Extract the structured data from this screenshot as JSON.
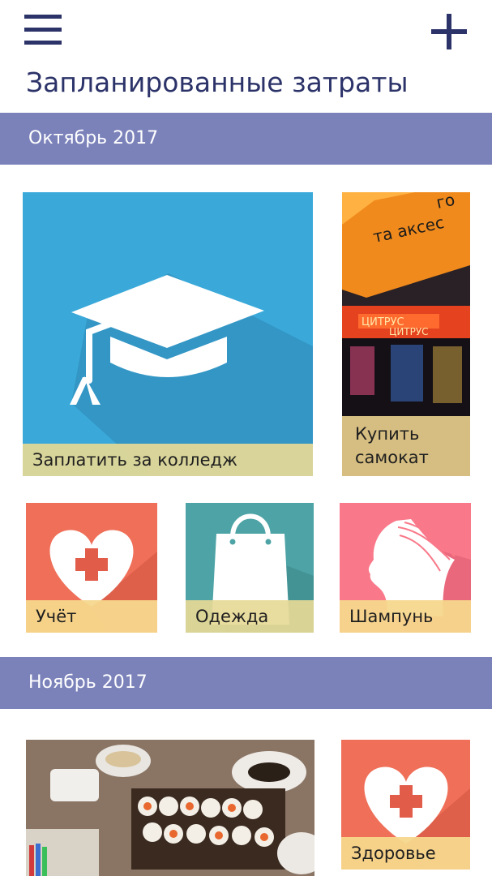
{
  "header": {
    "menu_icon": "hamburger-menu-icon",
    "add_icon": "plus-icon",
    "title": "Запланированные затраты"
  },
  "colors": {
    "accent": "#2c3369",
    "month_band": "#7b82ba",
    "college_tile": "#3aa9d9",
    "heart_tile": "#ef6f58",
    "bag_tile": "#4da3a5",
    "shampoo_tile": "#f9798a",
    "label_bg": "#e6d996"
  },
  "sections": [
    {
      "month": "Октябрь 2017",
      "tiles": [
        {
          "label": "Заплатить за колледж",
          "icon": "graduation-cap-icon"
        },
        {
          "label": "Купить самокат",
          "image": "store-photo"
        },
        {
          "label": "Учёт",
          "icon": "heart-cross-icon"
        },
        {
          "label": "Одежда",
          "icon": "shopping-bag-icon"
        },
        {
          "label": "Шампунь",
          "icon": "woman-hair-icon"
        }
      ]
    },
    {
      "month": "Ноябрь 2017",
      "tiles": [
        {
          "label": "",
          "image": "sushi-photo"
        },
        {
          "label": "Здоровье",
          "icon": "heart-cross-icon"
        }
      ]
    }
  ],
  "store_sign": {
    "line1": "го",
    "line2": "та аксес",
    "sign1": "ЦИТРУС",
    "sign2": "ЦИТРУС"
  }
}
